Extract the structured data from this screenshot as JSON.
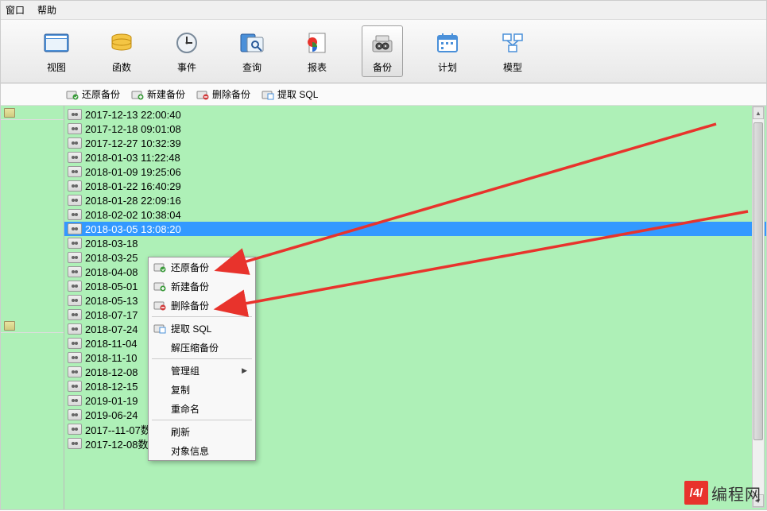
{
  "menubar": {
    "window": "窗口",
    "help": "帮助"
  },
  "toolbar": {
    "items": [
      {
        "id": "view",
        "label": "视图"
      },
      {
        "id": "function",
        "label": "函数"
      },
      {
        "id": "event",
        "label": "事件"
      },
      {
        "id": "query",
        "label": "查询"
      },
      {
        "id": "report",
        "label": "报表"
      },
      {
        "id": "backup",
        "label": "备份",
        "selected": true
      },
      {
        "id": "schedule",
        "label": "计划"
      },
      {
        "id": "model",
        "label": "模型"
      }
    ]
  },
  "subtoolbar": {
    "items": [
      {
        "id": "restore",
        "label": "还原备份"
      },
      {
        "id": "new",
        "label": "新建备份"
      },
      {
        "id": "delete",
        "label": "删除备份"
      },
      {
        "id": "extract",
        "label": "提取 SQL"
      }
    ]
  },
  "backups": [
    "2017-12-13 22:00:40",
    "2017-12-18 09:01:08",
    "2017-12-27 10:32:39",
    "2018-01-03 11:22:48",
    "2018-01-09 19:25:06",
    "2018-01-22 16:40:29",
    "2018-01-28 22:09:16",
    "2018-02-02 10:38:04",
    "2018-03-05 13:08:20",
    "2018-03-18",
    "2018-03-25",
    "2018-04-08",
    "2018-05-01",
    "2018-05-13",
    "2018-07-17",
    "2018-07-24",
    "2018-11-04",
    "2018-11-10",
    "2018-12-08",
    "2018-12-15",
    "2019-01-19",
    "2019-06-24",
    "2017--11-07数据库备份",
    "2017-12-08数据库备份"
  ],
  "selected_backup_index": 8,
  "context_menu": {
    "groups": [
      [
        {
          "id": "restore",
          "label": "还原备份",
          "icon": true
        },
        {
          "id": "new",
          "label": "新建备份",
          "icon": true
        },
        {
          "id": "delete",
          "label": "删除备份",
          "icon": true
        }
      ],
      [
        {
          "id": "extract",
          "label": "提取 SQL",
          "icon": true
        },
        {
          "id": "decompress",
          "label": "解压缩备份",
          "icon": false
        }
      ],
      [
        {
          "id": "group",
          "label": "管理组",
          "icon": false,
          "submenu": true
        },
        {
          "id": "copy",
          "label": "复制",
          "icon": false
        },
        {
          "id": "rename",
          "label": "重命名",
          "icon": false
        }
      ],
      [
        {
          "id": "refresh",
          "label": "刷新",
          "icon": false
        },
        {
          "id": "info",
          "label": "对象信息",
          "icon": false
        }
      ]
    ]
  },
  "watermark": {
    "logo": "/4/",
    "text": "编程网"
  }
}
